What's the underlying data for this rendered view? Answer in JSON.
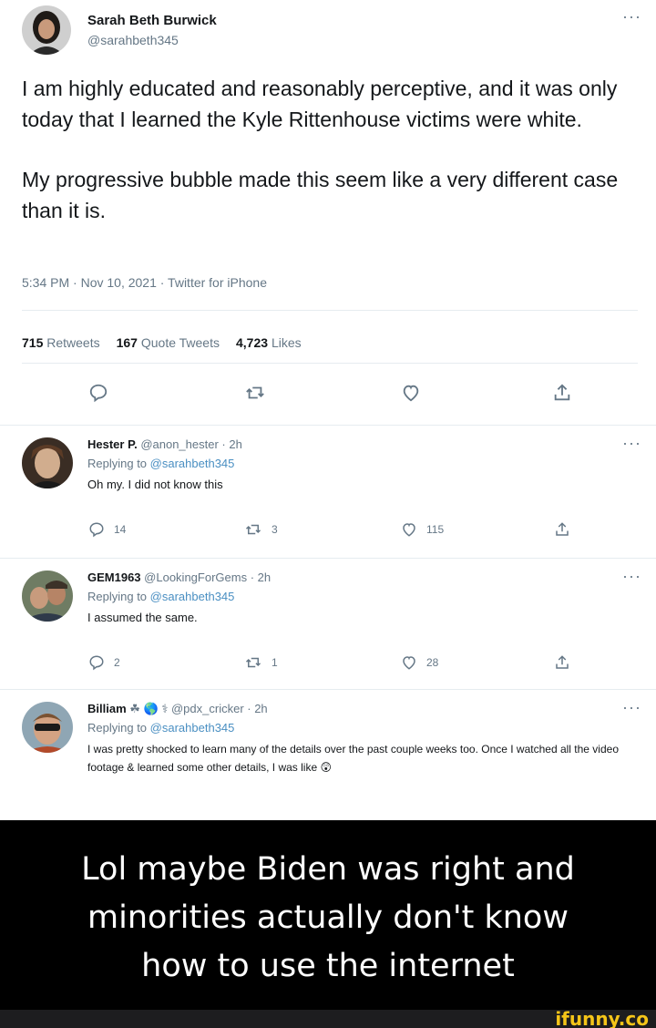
{
  "tweet": {
    "author_name": "Sarah Beth Burwick",
    "author_handle": "@sarahbeth345",
    "paragraphs": [
      "I am highly educated and reasonably perceptive, and it was only today that I learned the Kyle Rittenhouse victims were white.",
      "My progressive bubble made this seem like a very different case than it is."
    ],
    "timestamp": "5:34 PM · Nov 10, 2021 · Twitter for iPhone",
    "retweets_count": "715",
    "retweets_label": "Retweets",
    "quotes_count": "167",
    "quotes_label": "Quote Tweets",
    "likes_count": "4,723",
    "likes_label": "Likes",
    "more_glyph": "···"
  },
  "replies": [
    {
      "name": "Hester P.",
      "handle_time": "@anon_hester · 2h",
      "replying_prefix": "Replying to",
      "replying_to": "@sarahbeth345",
      "text": "Oh my. I did not know this",
      "reply_count": "14",
      "retweet_count": "3",
      "like_count": "115"
    },
    {
      "name": "GEM1963",
      "handle_time": "@LookingForGems · 2h",
      "replying_prefix": "Replying to",
      "replying_to": "@sarahbeth345",
      "text": "I assumed the same.",
      "reply_count": "2",
      "retweet_count": "1",
      "like_count": "28"
    },
    {
      "name": "Billiam",
      "name_emojis": "☘ 🌎 ⚕",
      "handle_time": "@pdx_cricker · 2h",
      "replying_prefix": "Replying to",
      "replying_to": "@sarahbeth345",
      "text": "I was pretty shocked to learn many of the details over the past couple weeks too. Once I watched all the video footage & learned some other details, I was like 😲"
    }
  ],
  "caption": {
    "lines": [
      "Lol maybe Biden was right and",
      "minorities actually don't know",
      "how to use the internet"
    ]
  },
  "watermark": "ifunny.co",
  "colors": {
    "text": "#14171a",
    "secondary": "#657786",
    "link": "#4a8fc2",
    "caption_bg": "#000000",
    "watermark": "#f5c518"
  }
}
